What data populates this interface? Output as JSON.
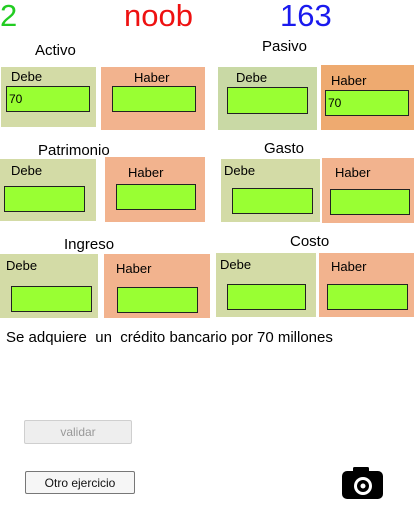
{
  "header": {
    "left_value": "2",
    "center_label": "noob",
    "right_value": "163",
    "colors": {
      "left": "#22cc22",
      "center": "#ee1111",
      "right": "#1a1aee"
    }
  },
  "common": {
    "debe": "Debe",
    "haber": "Haber"
  },
  "accounts": {
    "activo": {
      "title": "Activo",
      "debe_value": "70",
      "haber_value": ""
    },
    "pasivo": {
      "title": "Pasivo",
      "debe_value": "",
      "haber_value": "70"
    },
    "patrimonio": {
      "title": "Patrimonio",
      "debe_value": "",
      "haber_value": ""
    },
    "gasto": {
      "title": "Gasto",
      "debe_value": "",
      "haber_value": ""
    },
    "ingreso": {
      "title": "Ingreso",
      "debe_value": "",
      "haber_value": ""
    },
    "costo": {
      "title": "Costo",
      "debe_value": "",
      "haber_value": ""
    }
  },
  "problem": {
    "text": "Se adquiere  un  crédito bancario por 70 millones"
  },
  "buttons": {
    "validate": "validar",
    "next": "Otro ejercicio"
  },
  "icons": {
    "camera": "camera-icon"
  },
  "colors": {
    "debe_bg": "#d3dba6",
    "haber_bg": "#f2b38e",
    "field_bg": "#99ff33"
  }
}
